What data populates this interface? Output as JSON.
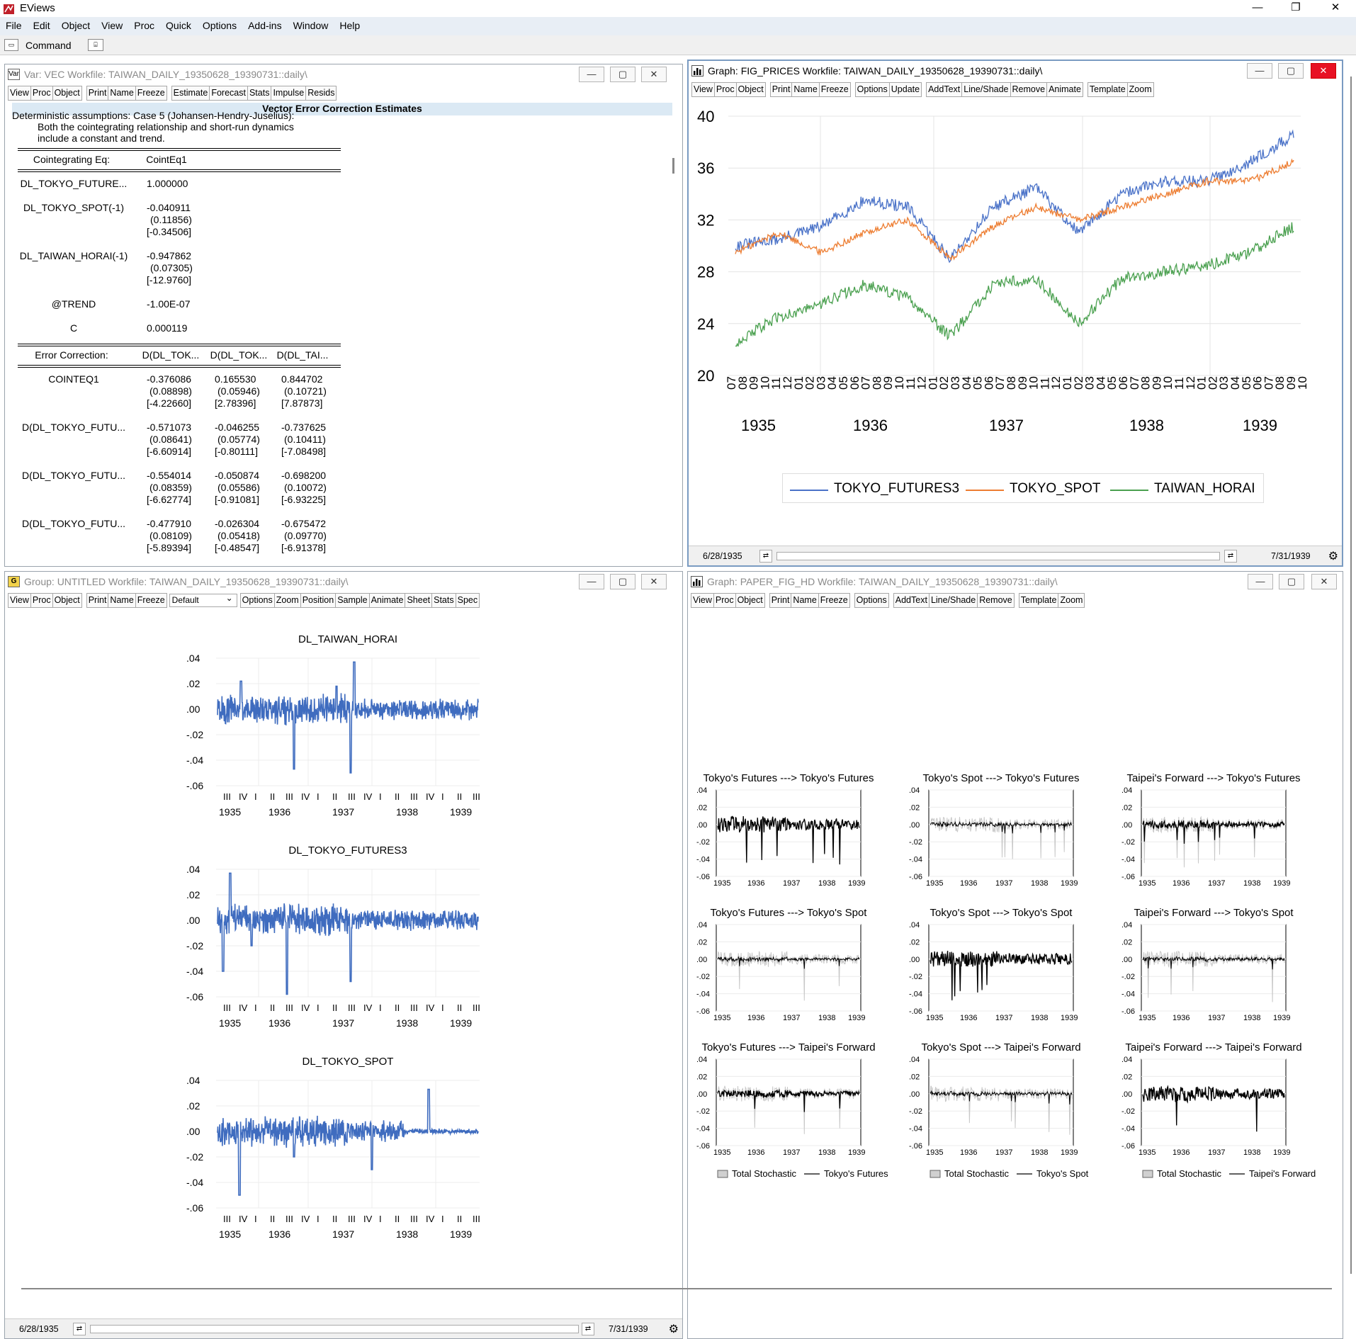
{
  "app": {
    "title": "EViews"
  },
  "menu": [
    "File",
    "Edit",
    "Object",
    "View",
    "Proc",
    "Quick",
    "Options",
    "Add-ins",
    "Window",
    "Help"
  ],
  "command": {
    "label": "Command"
  },
  "vec_window": {
    "icon": "Var",
    "title": "Var: VEC    Workfile: TAIWAN_DAILY_19350628_19390731::daily\\",
    "toolbar": [
      "View",
      "Proc",
      "Object",
      "Print",
      "Name",
      "Freeze",
      "Estimate",
      "Forecast",
      "Stats",
      "Impulse",
      "Resids"
    ],
    "header": "Vector Error Correction Estimates",
    "top_lines": [
      "Deterministic assumptions: Case 5 (Johansen-Hendry-Juselius):",
      "Both the cointegrating relationship and short-run dynamics",
      "include a constant and trend."
    ],
    "coint_header": {
      "label": "Cointegrating Eq:",
      "col": "CointEq1"
    },
    "coint_rows": [
      {
        "name": "DL_TOKYO_FUTURE...",
        "value": "1.000000",
        "se": "",
        "t": ""
      },
      {
        "name": "DL_TOKYO_SPOT(-1)",
        "value": "-0.040911",
        "se": "(0.11856)",
        "t": "[-0.34506]"
      },
      {
        "name": "DL_TAIWAN_HORAI(-1)",
        "value": "-0.947862",
        "se": "(0.07305)",
        "t": "[-12.9760]"
      },
      {
        "name": "@TREND",
        "value": "-1.00E-07",
        "se": "",
        "t": ""
      },
      {
        "name": "C",
        "value": "0.000119",
        "se": "",
        "t": ""
      }
    ],
    "ec_header": {
      "label": "Error Correction:",
      "cols": [
        "D(DL_TOK...",
        "D(DL_TOK...",
        "D(DL_TAI..."
      ]
    },
    "ec_rows": [
      {
        "name": "COINTEQ1",
        "v": [
          "-0.376086",
          "0.165530",
          "0.844702"
        ],
        "se": [
          "(0.08898)",
          "(0.05946)",
          "(0.10721)"
        ],
        "t": [
          "[-4.22660]",
          "[2.78396]",
          "[7.87873]"
        ]
      },
      {
        "name": "D(DL_TOKYO_FUTU...",
        "v": [
          "-0.571073",
          "-0.046255",
          "-0.737625"
        ],
        "se": [
          "(0.08641)",
          "(0.05774)",
          "(0.10411)"
        ],
        "t": [
          "[-6.60914]",
          "[-0.80111]",
          "[-7.08498]"
        ]
      },
      {
        "name": "D(DL_TOKYO_FUTU...",
        "v": [
          "-0.554014",
          "-0.050874",
          "-0.698200"
        ],
        "se": [
          "(0.08359)",
          "(0.05586)",
          "(0.10072)"
        ],
        "t": [
          "[-6.62774]",
          "[-0.91081]",
          "[-6.93225]"
        ]
      },
      {
        "name": "D(DL_TOKYO_FUTU...",
        "v": [
          "-0.477910",
          "-0.026304",
          "-0.675472"
        ],
        "se": [
          "(0.08109)",
          "(0.05418)",
          "(0.09770)"
        ],
        "t": [
          "[-5.89394]",
          "[-0.48547]",
          "[-6.91378]"
        ]
      }
    ]
  },
  "prices_window": {
    "title": "Graph: FIG_PRICES    Workfile: TAIWAN_DAILY_19350628_19390731::daily\\",
    "toolbar": [
      "View",
      "Proc",
      "Object",
      "Print",
      "Name",
      "Freeze",
      "Options",
      "Update",
      "AddText",
      "Line/Shade",
      "Remove",
      "Animate",
      "Template",
      "Zoom"
    ],
    "status": {
      "start": "6/28/1935",
      "end": "7/31/1939"
    },
    "colors": {
      "futures": "#4a72c8",
      "spot": "#ed7d31",
      "horai": "#4aa04f"
    }
  },
  "group_window": {
    "title": "Group: UNTITLED    Workfile: TAIWAN_DAILY_19350628_19390731::daily\\",
    "toolbar_left": [
      "View",
      "Proc",
      "Object",
      "Print",
      "Name",
      "Freeze"
    ],
    "dropdown": "Default",
    "toolbar_right": [
      "Options",
      "Zoom",
      "Position",
      "Sample",
      "Animate",
      "Sheet",
      "Stats",
      "Spec"
    ],
    "status": {
      "start": "6/28/1935",
      "end": "7/31/1939"
    },
    "quarter_labels": [
      "III",
      "IV",
      "I",
      "II",
      "III",
      "IV",
      "I",
      "II",
      "III",
      "IV",
      "I",
      "II",
      "III",
      "IV",
      "I",
      "II",
      "III"
    ]
  },
  "hd_window": {
    "title": "Graph: PAPER_FIG_HD    Workfile: TAIWAN_DAILY_19350628_19390731::daily\\",
    "toolbar": [
      "View",
      "Proc",
      "Object",
      "Print",
      "Name",
      "Freeze",
      "Options",
      "AddText",
      "Line/Shade",
      "Remove",
      "Template",
      "Zoom"
    ],
    "legends": [
      {
        "a": "Total Stochastic",
        "b": "Tokyo's Futures"
      },
      {
        "a": "Total Stochastic",
        "b": "Tokyo's Spot"
      },
      {
        "a": "Total Stochastic",
        "b": "Taipei's Forward"
      }
    ]
  },
  "chart_data": [
    {
      "type": "line",
      "title": "",
      "xlabel": "",
      "ylabel": "",
      "x_years": [
        "1935",
        "1936",
        "1937",
        "1938",
        "1939"
      ],
      "yticks": [
        "40",
        "36",
        "32",
        "28",
        "24",
        "20"
      ],
      "ylim": [
        20,
        40
      ],
      "grid": true,
      "legend": "bottom",
      "series": [
        {
          "name": "TOKYO_FUTURES3",
          "approx_values": [
            30.0,
            30.5,
            31.5,
            33.5,
            33.0,
            29.0,
            33.0,
            34.5,
            31.0,
            34.0,
            35.0,
            35.0,
            36.5,
            38.5
          ]
        },
        {
          "name": "TOKYO_SPOT",
          "approx_values": [
            29.5,
            31.0,
            29.5,
            31.0,
            32.0,
            29.0,
            31.5,
            33.0,
            32.0,
            33.0,
            34.0,
            35.0,
            35.0,
            36.5
          ]
        },
        {
          "name": "TAIWAN_HORAI",
          "approx_values": [
            22.5,
            24.5,
            25.5,
            27.0,
            26.0,
            23.0,
            27.0,
            27.5,
            24.0,
            27.5,
            28.0,
            28.5,
            29.5,
            31.5
          ]
        }
      ]
    },
    {
      "type": "line",
      "title": "DL_TAIWAN_HORAI",
      "yticks": [
        ".04",
        ".02",
        ".00",
        "-.02",
        "-.04",
        "-.06"
      ],
      "ylim": [
        -0.06,
        0.04
      ],
      "x_years": [
        "1935",
        "1936",
        "1937",
        "1938",
        "1939"
      ],
      "series": [
        {
          "name": "DL_TAIWAN_HORAI",
          "approx_extremes": {
            "max": 0.037,
            "min": -0.052
          }
        }
      ]
    },
    {
      "type": "line",
      "title": "DL_TOKYO_FUTURES3",
      "yticks": [
        ".04",
        ".02",
        ".00",
        "-.02",
        "-.04",
        "-.06"
      ],
      "ylim": [
        -0.06,
        0.04
      ],
      "x_years": [
        "1935",
        "1936",
        "1937",
        "1938",
        "1939"
      ],
      "series": [
        {
          "name": "DL_TOKYO_FUTURES3",
          "approx_extremes": {
            "max": 0.037,
            "min": -0.059
          }
        }
      ]
    },
    {
      "type": "line",
      "title": "DL_TOKYO_SPOT",
      "yticks": [
        ".04",
        ".02",
        ".00",
        "-.02",
        "-.04",
        "-.06"
      ],
      "ylim": [
        -0.06,
        0.04
      ],
      "x_years": [
        "1935",
        "1936",
        "1937",
        "1938",
        "1939"
      ],
      "series": [
        {
          "name": "DL_TOKYO_SPOT",
          "approx_extremes": {
            "max": 0.033,
            "min": -0.05
          }
        }
      ]
    },
    {
      "type": "line",
      "title": "Historical decomposition panels",
      "panels": [
        {
          "title": "Tokyo's Futures ---> Tokyo's Futures"
        },
        {
          "title": "Tokyo's Spot ---> Tokyo's Futures"
        },
        {
          "title": "Taipei's Forward ---> Tokyo's Futures"
        },
        {
          "title": "Tokyo's Futures ---> Tokyo's Spot"
        },
        {
          "title": "Tokyo's Spot ---> Tokyo's Spot"
        },
        {
          "title": "Taipei's Forward ---> Tokyo's Spot"
        },
        {
          "title": "Tokyo's Futures ---> Taipei's Forward"
        },
        {
          "title": "Tokyo's Spot ---> Taipei's Forward"
        },
        {
          "title": "Taipei's Forward ---> Taipei's Forward"
        }
      ],
      "yticks": [
        ".04",
        ".02",
        ".00",
        "-.02",
        "-.04",
        "-.06"
      ],
      "ylim": [
        -0.06,
        0.04
      ],
      "x_years": [
        "1935",
        "1936",
        "1937",
        "1938",
        "1939"
      ]
    }
  ]
}
